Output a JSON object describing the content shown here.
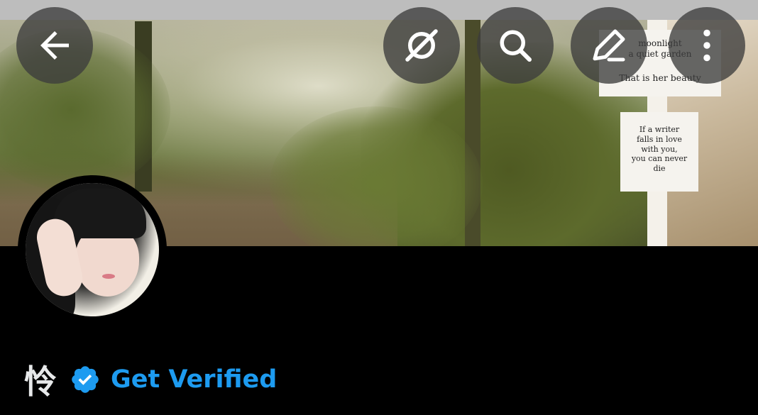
{
  "header": {
    "back_icon": "arrow-left-icon",
    "grok_icon": "grok-icon",
    "search_icon": "search-icon",
    "edit_icon": "edit-icon",
    "more_icon": "more-vertical-icon"
  },
  "banner": {
    "note_1": {
      "line_1": "moonlight",
      "line_2": "a quiet garden",
      "line_3": "That is her beauty"
    },
    "note_2": {
      "line_1": "If a writer",
      "line_2": "falls in love",
      "line_3": "with you,",
      "line_4": "you can never",
      "line_5": "die"
    }
  },
  "profile": {
    "name": "怜",
    "badge_icon": "verified-badge-icon",
    "get_verified_label": "Get Verified",
    "accent_color": "#1d9bf0"
  }
}
